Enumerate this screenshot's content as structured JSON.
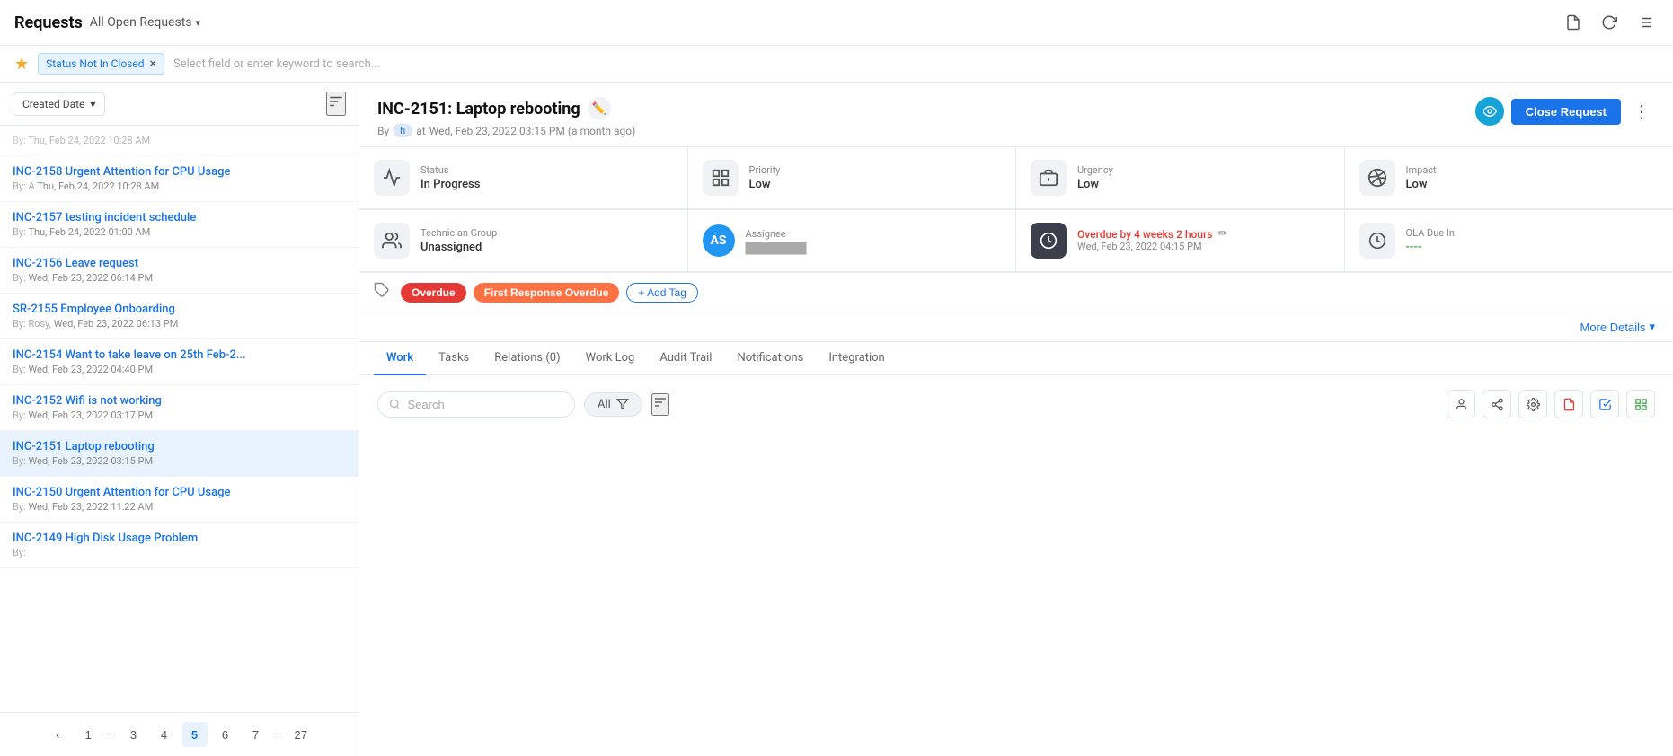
{
  "header": {
    "title": "Requests",
    "subtitle": "All Open Requests",
    "icons": [
      "document-icon",
      "refresh-icon",
      "list-icon"
    ]
  },
  "searchBar": {
    "filterTag": "Status Not In Closed",
    "placeholder": "Select field or enter keyword to search..."
  },
  "listHeader": {
    "sortLabel": "Created Date",
    "sortIcon": "sort-icon"
  },
  "listItems": [
    {
      "id": "item-1",
      "title": "INC-2158 Urgent Attention for CPU Usage",
      "by": "By: A",
      "date": "Thu, Feb 24, 2022 10:28 AM",
      "active": false
    },
    {
      "id": "item-2",
      "title": "INC-2157 testing incident schedule",
      "by": "By:",
      "date": "Thu, Feb 24, 2022 01:00 AM",
      "active": false
    },
    {
      "id": "item-3",
      "title": "INC-2156 Leave request",
      "by": "By:",
      "date": "Wed, Feb 23, 2022 06:14 PM",
      "active": false
    },
    {
      "id": "item-4",
      "title": "SR-2155 Employee Onboarding",
      "by": "By: Rosy,",
      "date": "Wed, Feb 23, 2022 06:13 PM",
      "active": false
    },
    {
      "id": "item-5",
      "title": "INC-2154 Want to take leave on 25th Feb-2...",
      "by": "By:",
      "date": "Wed, Feb 23, 2022 04:40 PM",
      "active": false
    },
    {
      "id": "item-6",
      "title": "INC-2152 Wifi is not working",
      "by": "By:",
      "date": "Wed, Feb 23, 2022 03:17 PM",
      "active": false
    },
    {
      "id": "item-7",
      "title": "INC-2151 Laptop rebooting",
      "by": "By:",
      "date": "Wed, Feb 23, 2022 03:15 PM",
      "active": true
    },
    {
      "id": "item-8",
      "title": "INC-2150 Urgent Attention for CPU Usage",
      "by": "By:",
      "date": "Wed, Feb 23, 2022 11:22 AM",
      "active": false
    },
    {
      "id": "item-9",
      "title": "INC-2149 High Disk Usage Problem",
      "by": "By:",
      "date": "",
      "active": false
    }
  ],
  "pagination": {
    "prev": "‹",
    "pages": [
      "1",
      "···",
      "3",
      "4",
      "5",
      "6",
      "7",
      "···",
      "27"
    ],
    "activePage": "5"
  },
  "detail": {
    "incidentId": "INC-2151: Laptop rebooting",
    "author": "h",
    "createdAt": "Wed, Feb 23, 2022 03:15 PM (a month ago)",
    "closeRequestLabel": "Close Request",
    "fields": {
      "status": {
        "label": "Status",
        "value": "In Progress"
      },
      "priority": {
        "label": "Priority",
        "value": "Low"
      },
      "urgency": {
        "label": "Urgency",
        "value": "Low"
      },
      "impact": {
        "label": "Impact",
        "value": "Low"
      },
      "techGroup": {
        "label": "Technician Group",
        "value": "Unassigned"
      },
      "assignee": {
        "label": "Assignee",
        "value": "AS",
        "name": ""
      },
      "dueDate": {
        "label": "Overdue by 4 weeks 2 hours",
        "value": "Wed, Feb 23, 2022 04:15 PM"
      },
      "olaDue": {
        "label": "OLA Due In",
        "value": "----"
      }
    },
    "tags": [
      "Overdue",
      "First Response Overdue",
      "+ Add Tag"
    ],
    "moreDetailsLabel": "More Details",
    "tabs": [
      "Work",
      "Tasks",
      "Relations (0)",
      "Work Log",
      "Audit Trail",
      "Notifications",
      "Integration"
    ],
    "activeTab": "Work",
    "workSearch": {
      "placeholder": "Search"
    },
    "workFilterLabel": "All"
  }
}
